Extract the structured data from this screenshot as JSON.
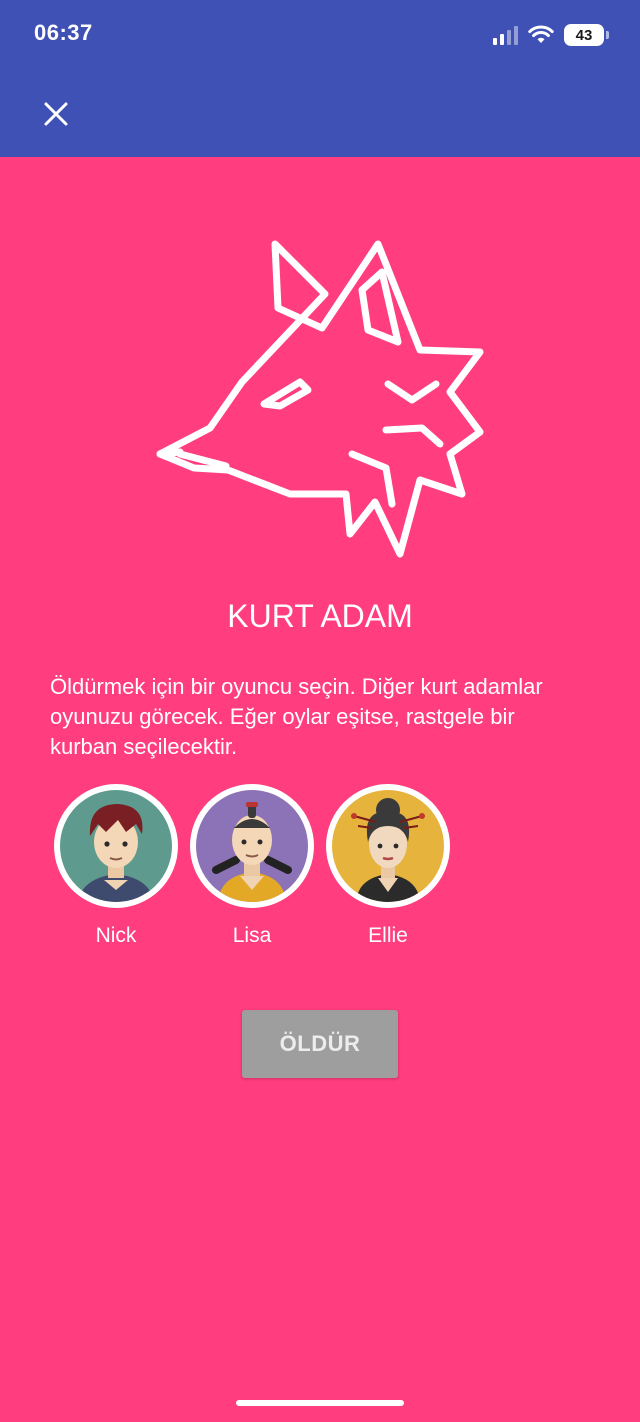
{
  "status_bar": {
    "time": "06:37",
    "battery": "43"
  },
  "app_bar": {
    "close_icon": "close-icon"
  },
  "role": {
    "icon": "wolf-head-icon",
    "title": "KURT ADAM",
    "instructions": "Öldürmek için bir oyuncu seçin. Diğer kurt adamlar oyunuzu görecek. Eğer oylar eşitse, rastgele bir kurban seçilecektir."
  },
  "players": [
    {
      "name": "Nick",
      "avatar_color": "#5e9b8e"
    },
    {
      "name": "Lisa",
      "avatar_color": "#8c72b6"
    },
    {
      "name": "Ellie",
      "avatar_color": "#e6b43c"
    }
  ],
  "actions": {
    "kill_label": "ÖLDÜR",
    "kill_enabled": false
  },
  "colors": {
    "background": "#ff3d7f",
    "app_bar": "#3f51b5",
    "button_disabled": "#9e9e9e"
  }
}
